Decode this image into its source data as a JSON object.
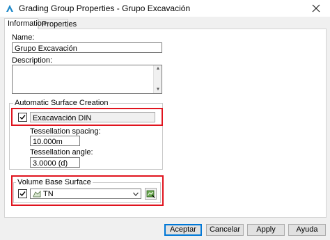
{
  "window": {
    "title": "Grading Group Properties - Grupo Excavación"
  },
  "tabs": [
    {
      "label": "Information"
    },
    {
      "label": "Properties"
    }
  ],
  "form": {
    "name_label": "Name:",
    "name_value": "Grupo Excavación",
    "description_label": "Description:",
    "description_value": ""
  },
  "auto_surface": {
    "group_title": "Automatic Surface Creation",
    "checked": true,
    "surface_name": "Exacavación DIN",
    "tessellation_spacing_label": "Tessellation spacing:",
    "tessellation_spacing_value": "10.000m",
    "tessellation_angle_label": "Tessellation angle:",
    "tessellation_angle_value": "3.0000 (d)"
  },
  "volume_base": {
    "group_title": "Volume Base Surface",
    "checked": true,
    "selected_surface": "TN"
  },
  "buttons": {
    "ok": "Aceptar",
    "cancel": "Cancelar",
    "apply": "Apply",
    "help": "Ayuda"
  },
  "colors": {
    "highlight_red": "#e0141e",
    "default_button_border": "#0078d7",
    "app_icon_blue": "#1e88c8"
  },
  "icons": {
    "app": "autodesk-a-icon",
    "close": "close-icon",
    "surface": "surface-icon",
    "pick": "pick-from-drawing-icon"
  }
}
